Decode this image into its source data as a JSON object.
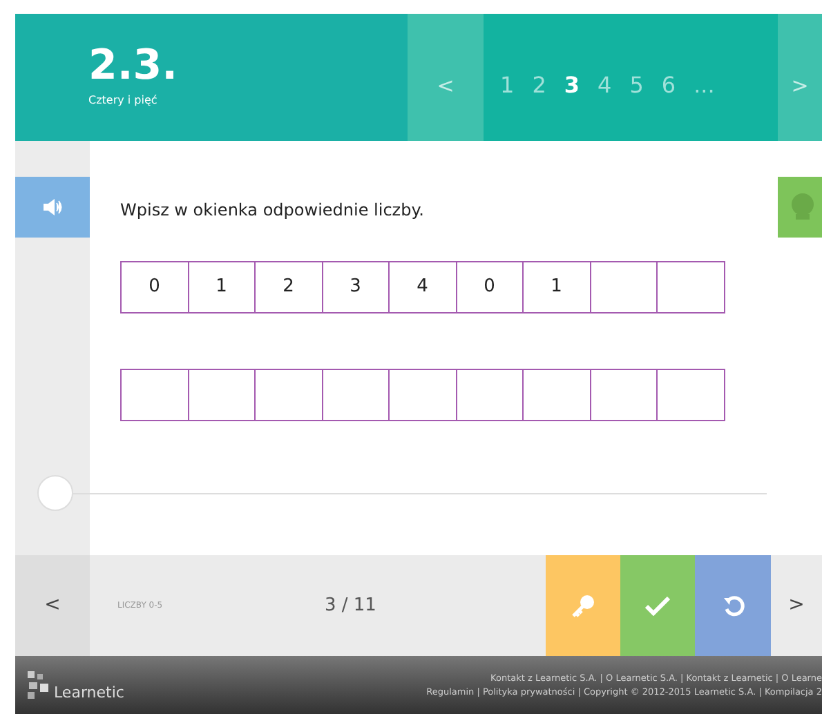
{
  "header": {
    "number": "2.3.",
    "subtitle": "Cztery i pięć",
    "prev": "<",
    "next": ">",
    "pages": [
      {
        "label": "1",
        "selected": false
      },
      {
        "label": "2",
        "selected": false
      },
      {
        "label": "3",
        "selected": true
      },
      {
        "label": "4",
        "selected": false
      },
      {
        "label": "5",
        "selected": false
      },
      {
        "label": "6",
        "selected": false
      },
      {
        "label": "...",
        "selected": false
      }
    ]
  },
  "instruction": "Wpisz w okienka odpowiednie liczby.",
  "rows": [
    {
      "cells": [
        {
          "kind": "filled",
          "value": "0"
        },
        {
          "kind": "filled",
          "value": "1"
        },
        {
          "kind": "filled",
          "value": "2"
        },
        {
          "kind": "filled",
          "value": "3"
        },
        {
          "kind": "filled",
          "value": "4"
        },
        {
          "kind": "filled",
          "value": "0"
        },
        {
          "kind": "filled",
          "value": "1"
        },
        {
          "kind": "empty"
        },
        {
          "kind": "empty"
        }
      ]
    },
    {
      "cells": [
        {
          "kind": "empty"
        },
        {
          "kind": "empty"
        },
        {
          "kind": "empty"
        },
        {
          "kind": "empty"
        },
        {
          "kind": "empty"
        },
        {
          "kind": "empty"
        },
        {
          "kind": "empty"
        },
        {
          "kind": "empty"
        },
        {
          "kind": "empty"
        }
      ]
    }
  ],
  "progress": {
    "level": 0
  },
  "bottom_bar": {
    "prev": "<",
    "next": ">",
    "topic": "LICZBY 0-5",
    "counter": "3 / 11"
  },
  "footer": {
    "brand": "Learnetic",
    "line_1": "Kontakt z Learnetic S.A. | O Learnetic S.A. | Kontakt z Learnetic | O Learne",
    "line_2": "Regulamin | Polityka prywatności | Copyright © 2012-2015 Learnetic S.A. | Kompilacja 2"
  }
}
